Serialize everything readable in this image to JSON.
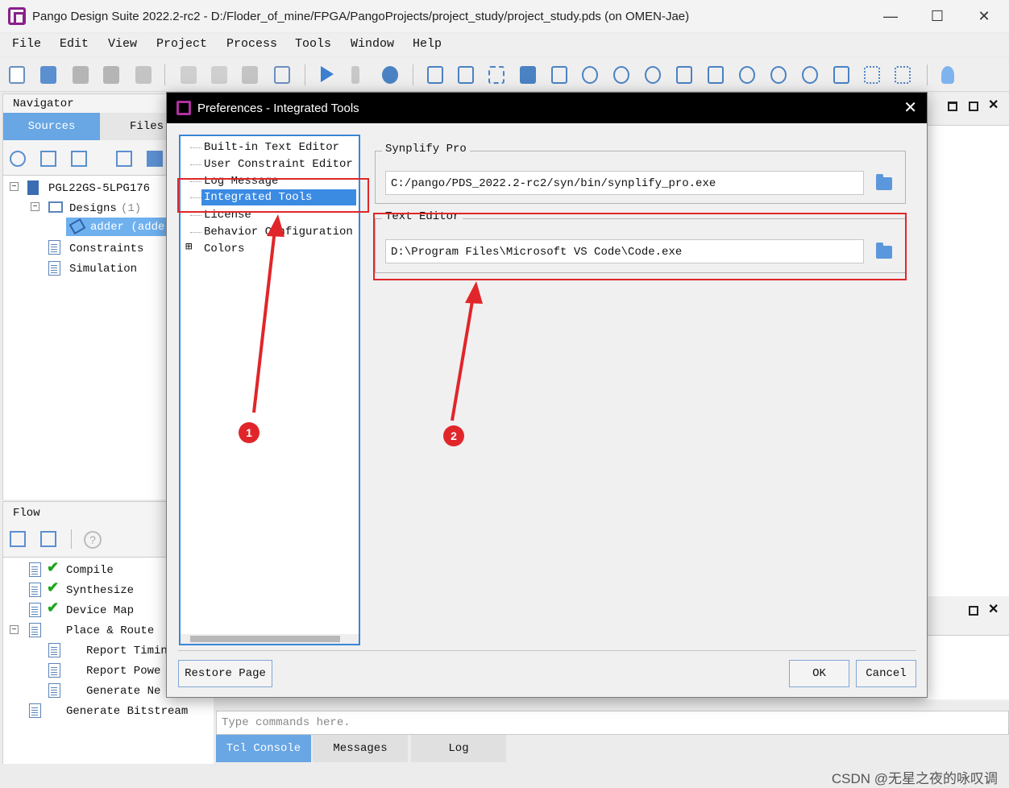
{
  "window": {
    "title": "Pango Design Suite 2022.2-rc2 - D:/Floder_of_mine/FPGA/PangoProjects/project_study/project_study.pds (on OMEN-Jae)",
    "minimize": "—",
    "maximize": "☐",
    "close": "✕"
  },
  "menu": [
    "File",
    "Edit",
    "View",
    "Project",
    "Process",
    "Tools",
    "Window",
    "Help"
  ],
  "navigator": {
    "title": "Navigator",
    "tabs": [
      "Sources",
      "Files"
    ],
    "tree": {
      "device": "PGL22GS-5LPG176",
      "designs": "Designs",
      "designs_count": "(1)",
      "adder": "adder (adde",
      "constraints": "Constraints",
      "simulation": "Simulation"
    }
  },
  "flow": {
    "title": "Flow",
    "help": "?",
    "items": [
      "Compile",
      "Synthesize",
      "Device Map",
      "Place & Route",
      "Report Timin",
      "Report Powe",
      "Generate Ne",
      "Generate Bitstream"
    ]
  },
  "console": {
    "placeholder": "Type commands here.",
    "tabs": [
      "Tcl Console",
      "Messages",
      "Log"
    ]
  },
  "watermark": "CSDN @无星之夜的咏叹调",
  "dialog": {
    "title": "Preferences - Integrated Tools",
    "close": "✕",
    "tree": [
      "Built-in Text Editor",
      "User Constraint Editor",
      "Log Message",
      "Integrated Tools",
      "License",
      "Behavior Configuration",
      "Colors"
    ],
    "expand": "⊞",
    "synplify": {
      "label": "Synplify Pro",
      "path": "C:/pango/PDS_2022.2-rc2/syn/bin/synplify_pro.exe"
    },
    "text_editor": {
      "label": "Text Editor",
      "path": "D:\\Program Files\\Microsoft VS Code\\Code.exe"
    },
    "buttons": {
      "restore": "Restore Page",
      "ok": "OK",
      "cancel": "Cancel"
    }
  },
  "annotations": {
    "badge1": "1",
    "badge2": "2"
  },
  "colors": {
    "accent": "#3b8be3",
    "annotation_red": "#e0262a",
    "check_green": "#1aa61a"
  }
}
